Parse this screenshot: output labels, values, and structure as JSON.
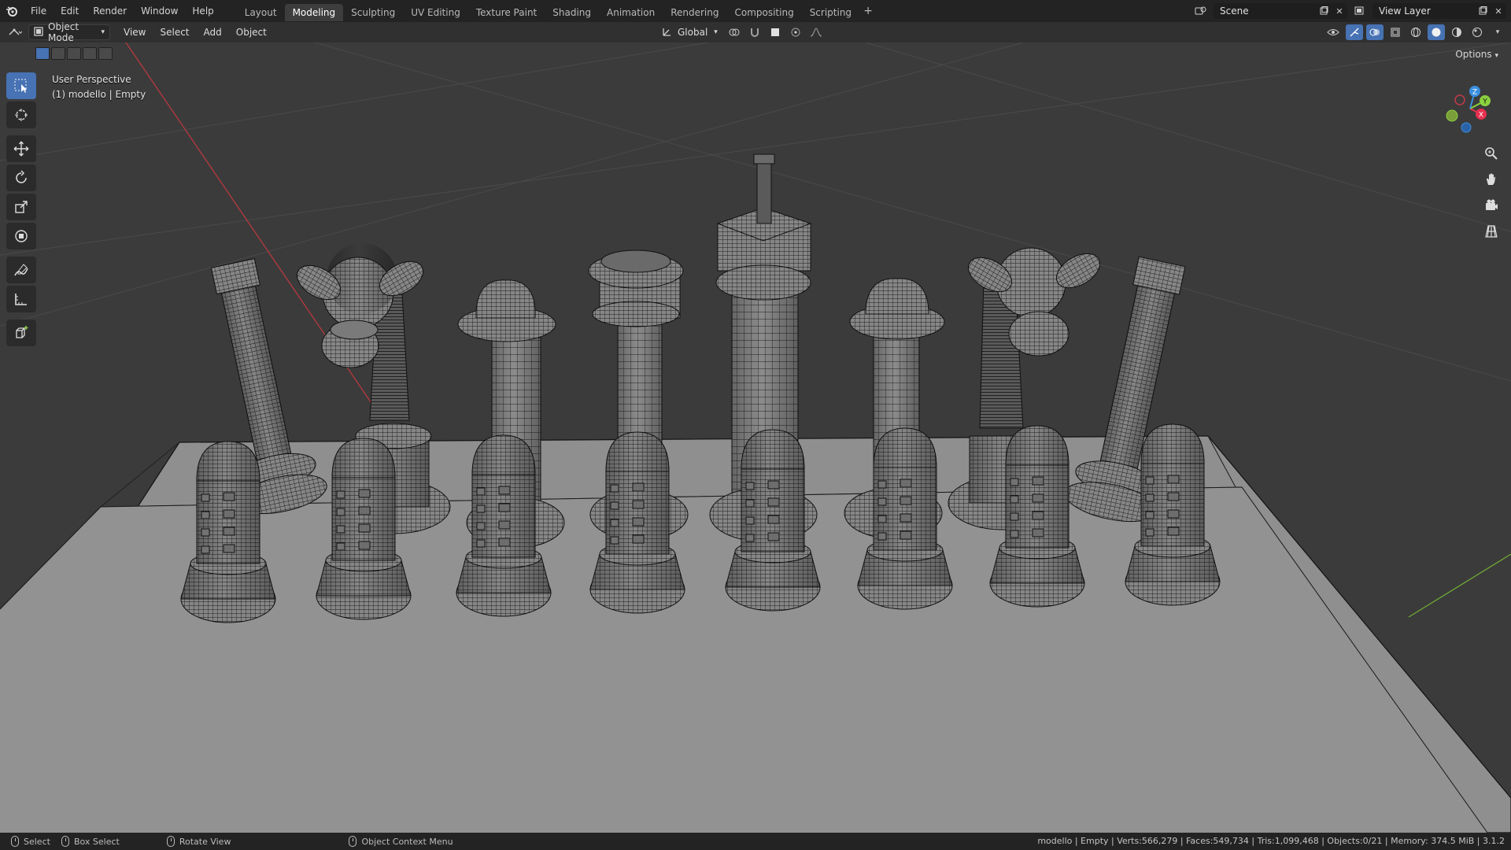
{
  "topbar": {
    "menus": [
      "File",
      "Edit",
      "Render",
      "Window",
      "Help"
    ],
    "workspaces": [
      "Layout",
      "Modeling",
      "Sculpting",
      "UV Editing",
      "Texture Paint",
      "Shading",
      "Animation",
      "Rendering",
      "Compositing",
      "Scripting"
    ],
    "active_workspace": "Modeling",
    "add_tab": "+",
    "scene_name": "Scene",
    "view_layer": "View Layer"
  },
  "header": {
    "mode": "Object Mode",
    "menus": [
      "View",
      "Select",
      "Add",
      "Object"
    ],
    "transform_orientation": "Global",
    "options_label": "Options"
  },
  "viewport": {
    "perspective_label": "User Perspective",
    "object_label": "(1) modello | Empty"
  },
  "gizmo": {
    "axes": [
      "X",
      "Y",
      "Z"
    ],
    "colors": {
      "x": "#e8304f",
      "y": "#8bd13f",
      "z": "#3b8fe0"
    }
  },
  "statusbar": {
    "select": "Select",
    "box_select": "Box Select",
    "rotate_view": "Rotate View",
    "context_menu": "Object Context Menu",
    "stats": "modello | Empty | Verts:566,279 | Faces:549,734 | Tris:1,099,468 | Objects:0/21 | Memory: 374.5 MiB | 3.1.2"
  },
  "colors": {
    "accent": "#4772b3",
    "viewport_bg": "#3b3b3b",
    "piece_fill": "#8e8e8e",
    "wire": "#1c1c1c",
    "board": "#8a8a8a"
  }
}
